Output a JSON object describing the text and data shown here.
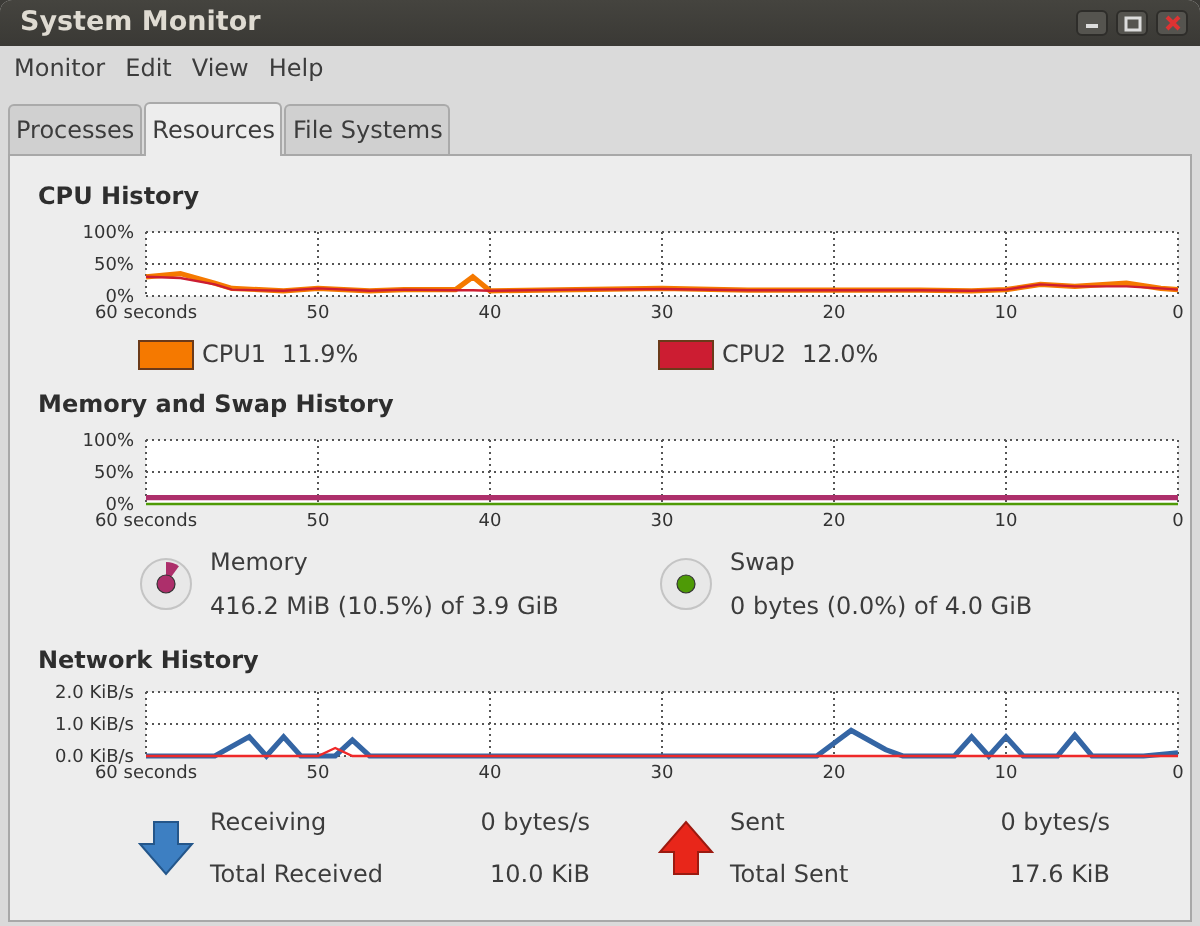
{
  "window": {
    "title": "System Monitor"
  },
  "menu": [
    "Monitor",
    "Edit",
    "View",
    "Help"
  ],
  "tabs": [
    {
      "label": "Processes",
      "selected": false
    },
    {
      "label": "Resources",
      "selected": true
    },
    {
      "label": "File Systems",
      "selected": false
    }
  ],
  "cpu": {
    "title": "CPU History",
    "chart_data": {
      "type": "line",
      "grid": true,
      "x": [
        60,
        58,
        56,
        55,
        52,
        50,
        47,
        45,
        42,
        41,
        40,
        35,
        30,
        25,
        20,
        15,
        12,
        10,
        8,
        6,
        3,
        1,
        0
      ],
      "xlim": [
        60,
        0
      ],
      "ylim": [
        0,
        100
      ],
      "xticks": [
        {
          "value": 60,
          "label": "60 seconds"
        },
        50,
        40,
        30,
        20,
        10,
        0
      ],
      "yticks": [
        {
          "value": 0,
          "label": "0%"
        },
        {
          "value": 50,
          "label": "50%"
        },
        {
          "value": 100,
          "label": "100%"
        }
      ],
      "series": [
        {
          "name": "CPU1",
          "color": "#f57900",
          "values": [
            30,
            35,
            20,
            12,
            8,
            12,
            8,
            10,
            10,
            30,
            8,
            10,
            12,
            9,
            9,
            9,
            8,
            10,
            18,
            15,
            20,
            12,
            10
          ]
        },
        {
          "name": "CPU2",
          "color": "#cc1d32",
          "values": [
            30,
            28,
            18,
            10,
            8,
            12,
            8,
            10,
            9,
            9,
            8,
            10,
            11,
            9,
            9,
            9,
            8,
            10,
            18,
            15,
            15,
            12,
            10
          ]
        }
      ]
    },
    "legend": [
      {
        "reading": "11.9%"
      },
      {
        "reading": "12.0%"
      }
    ]
  },
  "memory": {
    "title": "Memory and Swap History",
    "chart_data": {
      "type": "line",
      "grid": true,
      "x": [
        60,
        0
      ],
      "xlim": [
        60,
        0
      ],
      "ylim": [
        0,
        100
      ],
      "xticks": [
        {
          "value": 60,
          "label": "60 seconds"
        },
        50,
        40,
        30,
        20,
        10,
        0
      ],
      "yticks": [
        {
          "value": 0,
          "label": "0%"
        },
        {
          "value": 50,
          "label": "50%"
        },
        {
          "value": 100,
          "label": "100%"
        }
      ],
      "series": [
        {
          "name": "Memory",
          "color": "#ad2f6b",
          "values": [
            10,
            10
          ]
        },
        {
          "name": "Swap",
          "color": "#4e9a06",
          "values": [
            0,
            0
          ]
        }
      ]
    },
    "legend": [
      {
        "detail": "416.2 MiB (10.5%) of 3.9 GiB"
      },
      {
        "detail": "0 bytes (0.0%) of 4.0 GiB"
      }
    ]
  },
  "network": {
    "title": "Network History",
    "chart_data": {
      "type": "line",
      "grid": true,
      "x": [
        60,
        56,
        54,
        53,
        52,
        51,
        50,
        49,
        48,
        47,
        21,
        19,
        17,
        16,
        13,
        12,
        11,
        10,
        9,
        7,
        6,
        5,
        2,
        0
      ],
      "xlim": [
        60,
        0
      ],
      "ylim": [
        0,
        2
      ],
      "xticks": [
        {
          "value": 60,
          "label": "60 seconds"
        },
        50,
        40,
        30,
        20,
        10,
        0
      ],
      "yticks": [
        {
          "value": 0,
          "label": "0.0 KiB/s"
        },
        {
          "value": 1,
          "label": "1.0 KiB/s"
        },
        {
          "value": 2,
          "label": "2.0 KiB/s"
        }
      ],
      "series": [
        {
          "name": "Receiving",
          "color": "#3465a4",
          "values": [
            0,
            0,
            0.6,
            0,
            0.6,
            0,
            0,
            0,
            0.5,
            0,
            0,
            0.8,
            0.2,
            0,
            0,
            0.6,
            0,
            0.6,
            0,
            0,
            0.65,
            0,
            0,
            0.1
          ]
        },
        {
          "name": "Sent",
          "color": "#ef2929",
          "values": [
            0,
            0,
            0,
            0,
            0,
            0,
            0,
            0.25,
            0,
            0,
            0,
            0,
            0,
            0,
            0,
            0,
            0,
            0,
            0,
            0,
            0,
            0,
            0,
            0
          ]
        }
      ]
    },
    "legend": [
      {
        "rate": "0 bytes/s",
        "total_label": "Total Received",
        "total": "10.0 KiB"
      },
      {
        "rate": "0 bytes/s",
        "total_label": "Total Sent",
        "total": "17.6 KiB"
      }
    ]
  }
}
